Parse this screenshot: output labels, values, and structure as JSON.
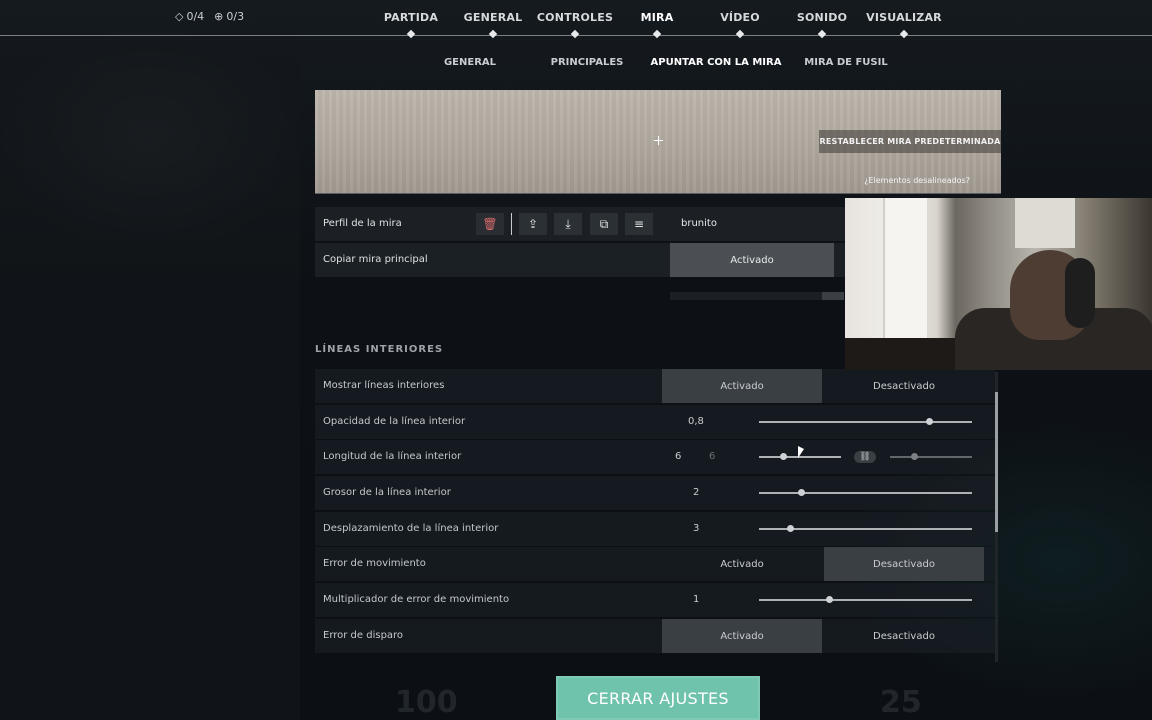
{
  "header": {
    "counter_left": "0/4",
    "counter_right": "0/3",
    "tabs": [
      {
        "label": "PARTIDA",
        "active": false
      },
      {
        "label": "GENERAL",
        "active": false
      },
      {
        "label": "CONTROLES",
        "active": false
      },
      {
        "label": "MIRA",
        "active": true
      },
      {
        "label": "VÍDEO",
        "active": false
      },
      {
        "label": "SONIDO",
        "active": false
      },
      {
        "label": "VISUALIZAR",
        "active": false
      }
    ]
  },
  "subtabs": [
    {
      "label": "GENERAL",
      "active": false
    },
    {
      "label": "PRINCIPALES",
      "active": false
    },
    {
      "label": "APUNTAR CON LA MIRA",
      "active": true
    },
    {
      "label": "MIRA DE FUSIL",
      "active": false
    }
  ],
  "preview": {
    "reset_label": "RESTABLECER MIRA PREDETERMINADA",
    "misaligned_label": "¿Elementos desalineados?"
  },
  "profile": {
    "label": "Perfil de la mira",
    "name": "brunito",
    "icons": [
      "trash-icon",
      "upload-icon",
      "download-icon",
      "copy-icon",
      "rename-icon"
    ]
  },
  "copy_main": {
    "label": "Copiar mira principal",
    "value": "Activado"
  },
  "section": {
    "title": "LÍNEAS INTERIORES"
  },
  "settings": {
    "show_lines": {
      "label": "Mostrar líneas interiores",
      "on": "Activado",
      "off": "Desactivado",
      "selected": "Activado"
    },
    "opacity": {
      "label": "Opacidad de la línea interior",
      "value": "0,8",
      "fraction": 0.8
    },
    "length": {
      "label": "Longitud de la línea interior",
      "value": "6",
      "value2": "6",
      "fraction": 0.3,
      "fraction2": 0.3
    },
    "thickness": {
      "label": "Grosor de la línea interior",
      "value": "2",
      "fraction": 0.2
    },
    "offset": {
      "label": "Desplazamiento de la línea interior",
      "value": "3",
      "fraction": 0.15
    },
    "movement_error": {
      "label": "Error de movimiento",
      "on": "Activado",
      "off": "Desactivado",
      "selected": "Desactivado"
    },
    "movement_mult": {
      "label": "Multiplicador de error de movimiento",
      "value": "1",
      "fraction": 0.33
    },
    "firing_error": {
      "label": "Error de disparo",
      "on": "Activado",
      "off": "Desactivado",
      "selected": "Activado"
    }
  },
  "hud": {
    "left_number": "100",
    "right_number": "25"
  },
  "footer": {
    "close_label": "CERRAR AJUSTES"
  },
  "colors": {
    "accent": "#6fc2ab",
    "delete": "#d96b6b"
  }
}
